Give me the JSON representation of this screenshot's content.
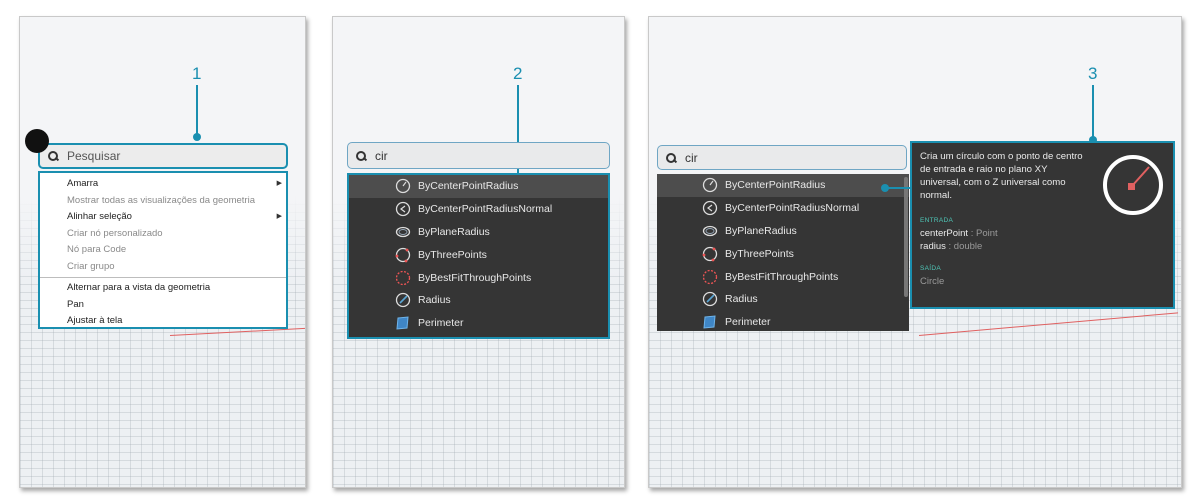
{
  "callouts": [
    "1",
    "2",
    "3"
  ],
  "accent_color": "#1a8fb0",
  "panel1": {
    "search_placeholder": "Pesquisar",
    "menu_items": [
      {
        "label": "Amarra",
        "disabled": false,
        "submenu": true
      },
      {
        "label": "Mostrar todas as visualizações da geometria",
        "disabled": true,
        "submenu": false
      },
      {
        "label": "Alinhar seleção",
        "disabled": false,
        "submenu": true
      },
      {
        "label": "Criar nó personalizado",
        "disabled": true,
        "submenu": false
      },
      {
        "label": "Nó para Code",
        "disabled": true,
        "submenu": false
      },
      {
        "label": "Criar grupo",
        "disabled": true,
        "submenu": false
      },
      {
        "label": "Alternar para a vista da geometria",
        "disabled": false,
        "submenu": false
      },
      {
        "label": "Pan",
        "disabled": false,
        "submenu": false
      },
      {
        "label": "Ajustar à tela",
        "disabled": false,
        "submenu": false
      }
    ]
  },
  "panel2": {
    "search_value": "cir",
    "results": [
      {
        "label": "ByCenterPointRadius",
        "icon": "circle-center-radius-icon"
      },
      {
        "label": "ByCenterPointRadiusNormal",
        "icon": "circle-normal-icon"
      },
      {
        "label": "ByPlaneRadius",
        "icon": "circle-plane-icon"
      },
      {
        "label": "ByThreePoints",
        "icon": "circle-three-points-icon"
      },
      {
        "label": "ByBestFitThroughPoints",
        "icon": "circle-best-fit-icon"
      },
      {
        "label": "Radius",
        "icon": "radius-icon"
      },
      {
        "label": "Perimeter",
        "icon": "perimeter-icon"
      }
    ]
  },
  "panel3": {
    "search_value": "cir",
    "results": [
      {
        "label": "ByCenterPointRadius",
        "icon": "circle-center-radius-icon"
      },
      {
        "label": "ByCenterPointRadiusNormal",
        "icon": "circle-normal-icon"
      },
      {
        "label": "ByPlaneRadius",
        "icon": "circle-plane-icon"
      },
      {
        "label": "ByThreePoints",
        "icon": "circle-three-points-icon"
      },
      {
        "label": "ByBestFitThroughPoints",
        "icon": "circle-best-fit-icon"
      },
      {
        "label": "Radius",
        "icon": "radius-icon"
      },
      {
        "label": "Perimeter",
        "icon": "perimeter-icon"
      }
    ],
    "tooltip": {
      "description": "Cria um círculo com o ponto de centro de entrada e raio no plano XY universal, com o Z universal como normal.",
      "input_label": "ENTRADA",
      "inputs": [
        {
          "name": "centerPoint",
          "sep": " : ",
          "type": "Point"
        },
        {
          "name": "radius",
          "sep": " : ",
          "type": "double"
        }
      ],
      "output_label": "SAÍDA",
      "output": "Circle"
    }
  }
}
